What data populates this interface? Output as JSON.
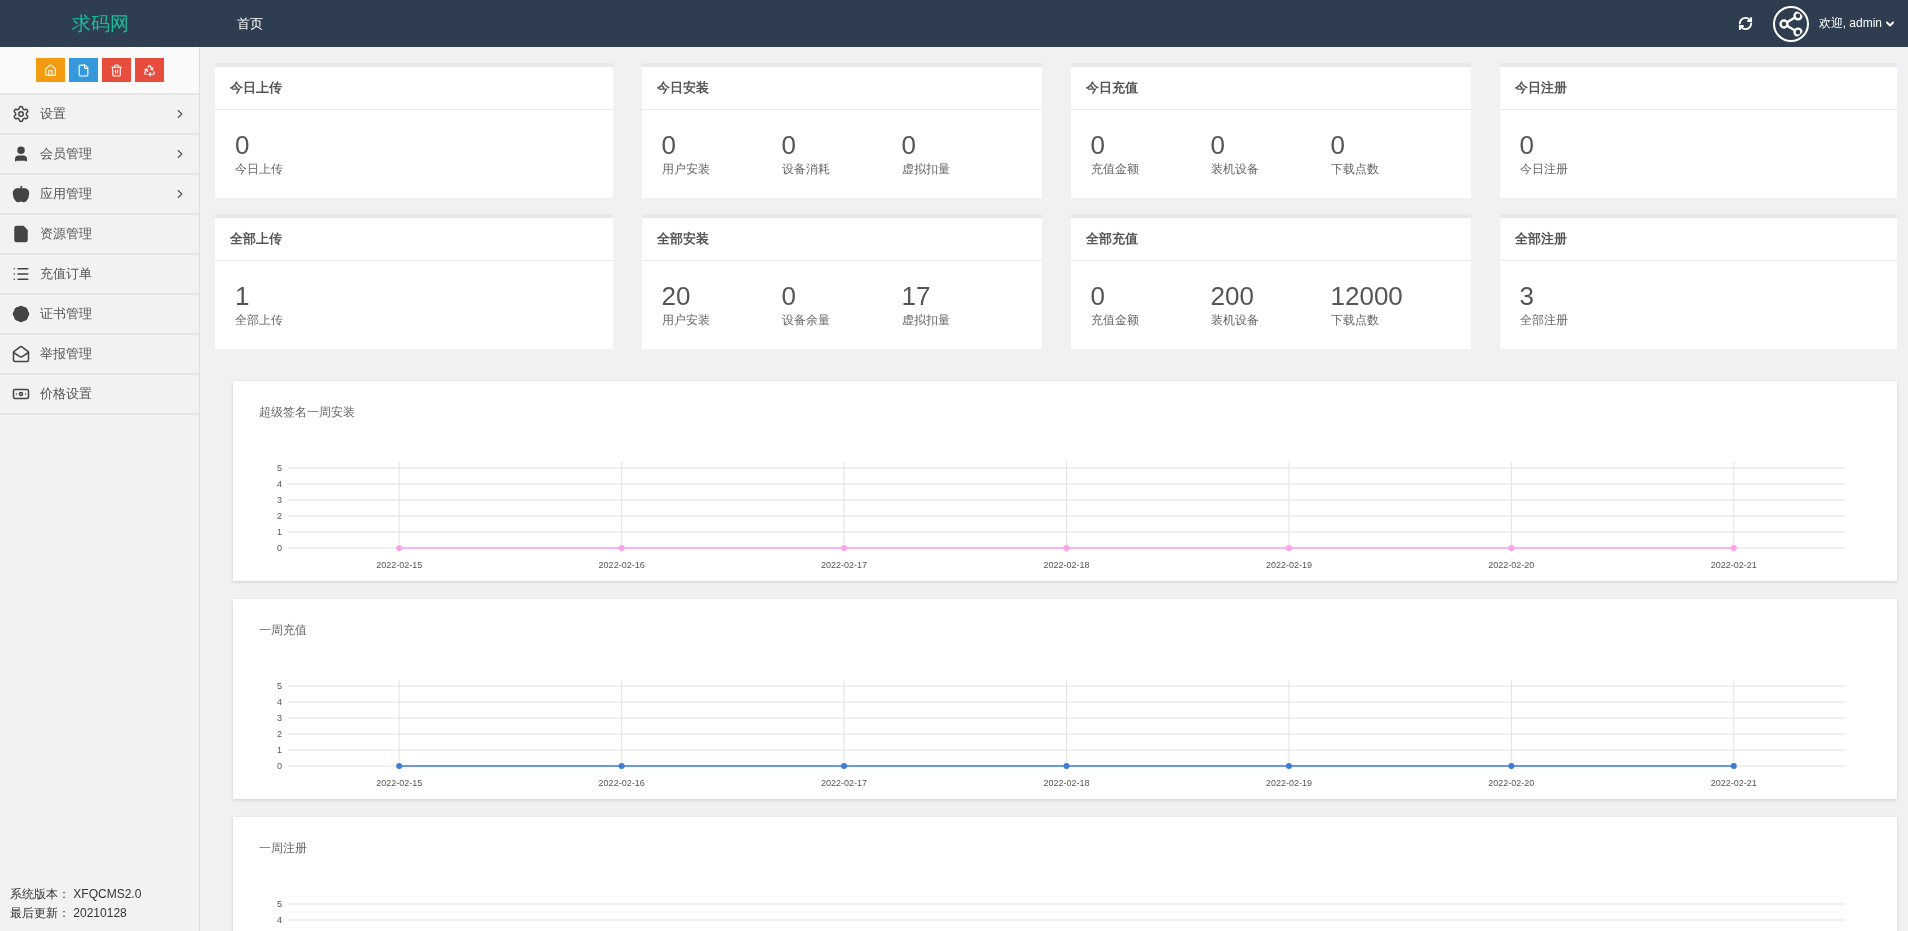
{
  "topbar": {
    "logo": "求码网",
    "nav": [
      {
        "label": "首页"
      }
    ],
    "welcome": "欢迎, admin"
  },
  "sidebar": {
    "quick_buttons": [
      {
        "kind": "home",
        "color": "#f39c12"
      },
      {
        "kind": "file",
        "color": "#3498db"
      },
      {
        "kind": "trash",
        "color": "#e74c3c"
      },
      {
        "kind": "recycle",
        "color": "#e74c3c"
      }
    ],
    "items": [
      {
        "kind": "gears",
        "label": "设置",
        "has_submenu": true
      },
      {
        "kind": "user",
        "label": "会员管理",
        "has_submenu": true
      },
      {
        "kind": "apple",
        "label": "应用管理",
        "has_submenu": true
      },
      {
        "kind": "file",
        "label": "资源管理",
        "has_submenu": false
      },
      {
        "kind": "list",
        "label": "充值订单",
        "has_submenu": false
      },
      {
        "kind": "badge",
        "label": "证书管理",
        "has_submenu": false
      },
      {
        "kind": "mail",
        "label": "举报管理",
        "has_submenu": false
      },
      {
        "kind": "money",
        "label": "价格设置",
        "has_submenu": false
      }
    ],
    "footer": [
      {
        "label": "系统版本：",
        "value": "XFQCMS2.0"
      },
      {
        "label": "最后更新：",
        "value": "20210128"
      }
    ]
  },
  "stat_cards": [
    {
      "title": "今日上传",
      "stats": [
        {
          "value": "0",
          "label": "今日上传"
        }
      ]
    },
    {
      "title": "今日安装",
      "stats": [
        {
          "value": "0",
          "label": "用户安装"
        },
        {
          "value": "0",
          "label": "设备消耗"
        },
        {
          "value": "0",
          "label": "虚拟扣量"
        }
      ]
    },
    {
      "title": "今日充值",
      "stats": [
        {
          "value": "0",
          "label": "充值金额"
        },
        {
          "value": "0",
          "label": "装机设备"
        },
        {
          "value": "0",
          "label": "下载点数"
        }
      ]
    },
    {
      "title": "今日注册",
      "stats": [
        {
          "value": "0",
          "label": "今日注册"
        }
      ]
    },
    {
      "title": "全部上传",
      "stats": [
        {
          "value": "1",
          "label": "全部上传"
        }
      ]
    },
    {
      "title": "全部安装",
      "stats": [
        {
          "value": "20",
          "label": "用户安装"
        },
        {
          "value": "0",
          "label": "设备余量"
        },
        {
          "value": "17",
          "label": "虚拟扣量"
        }
      ]
    },
    {
      "title": "全部充值",
      "stats": [
        {
          "value": "0",
          "label": "充值金额"
        },
        {
          "value": "200",
          "label": "装机设备"
        },
        {
          "value": "12000",
          "label": "下载点数"
        }
      ]
    },
    {
      "title": "全部注册",
      "stats": [
        {
          "value": "3",
          "label": "全部注册"
        }
      ]
    }
  ],
  "charts": [
    {
      "chart_data": {
        "type": "line",
        "title": "超级签名一周安装",
        "categories": [
          "2022-02-15",
          "2022-02-16",
          "2022-02-17",
          "2022-02-18",
          "2022-02-19",
          "2022-02-20",
          "2022-02-21"
        ],
        "ylim": [
          0,
          5
        ],
        "yticks": [
          0,
          1,
          2,
          3,
          4,
          5
        ],
        "grid": true,
        "series": [
          {
            "color": "#ffa0ea",
            "marker": "circle",
            "values": [
              0,
              0,
              0,
              0,
              0,
              0,
              0
            ]
          }
        ]
      }
    },
    {
      "chart_data": {
        "type": "line",
        "title": "一周充值",
        "categories": [
          "2022-02-15",
          "2022-02-16",
          "2022-02-17",
          "2022-02-18",
          "2022-02-19",
          "2022-02-20",
          "2022-02-21"
        ],
        "ylim": [
          0,
          5
        ],
        "yticks": [
          0,
          1,
          2,
          3,
          4,
          5
        ],
        "grid": true,
        "series": [
          {
            "color": "#3b7dd8",
            "marker": "circle",
            "values": [
              0,
              0,
              0,
              0,
              0,
              0,
              0
            ]
          }
        ]
      }
    }
  ],
  "partial_chart": {
    "title": "一周注册",
    "axis_labels": [
      "5",
      "4"
    ]
  }
}
